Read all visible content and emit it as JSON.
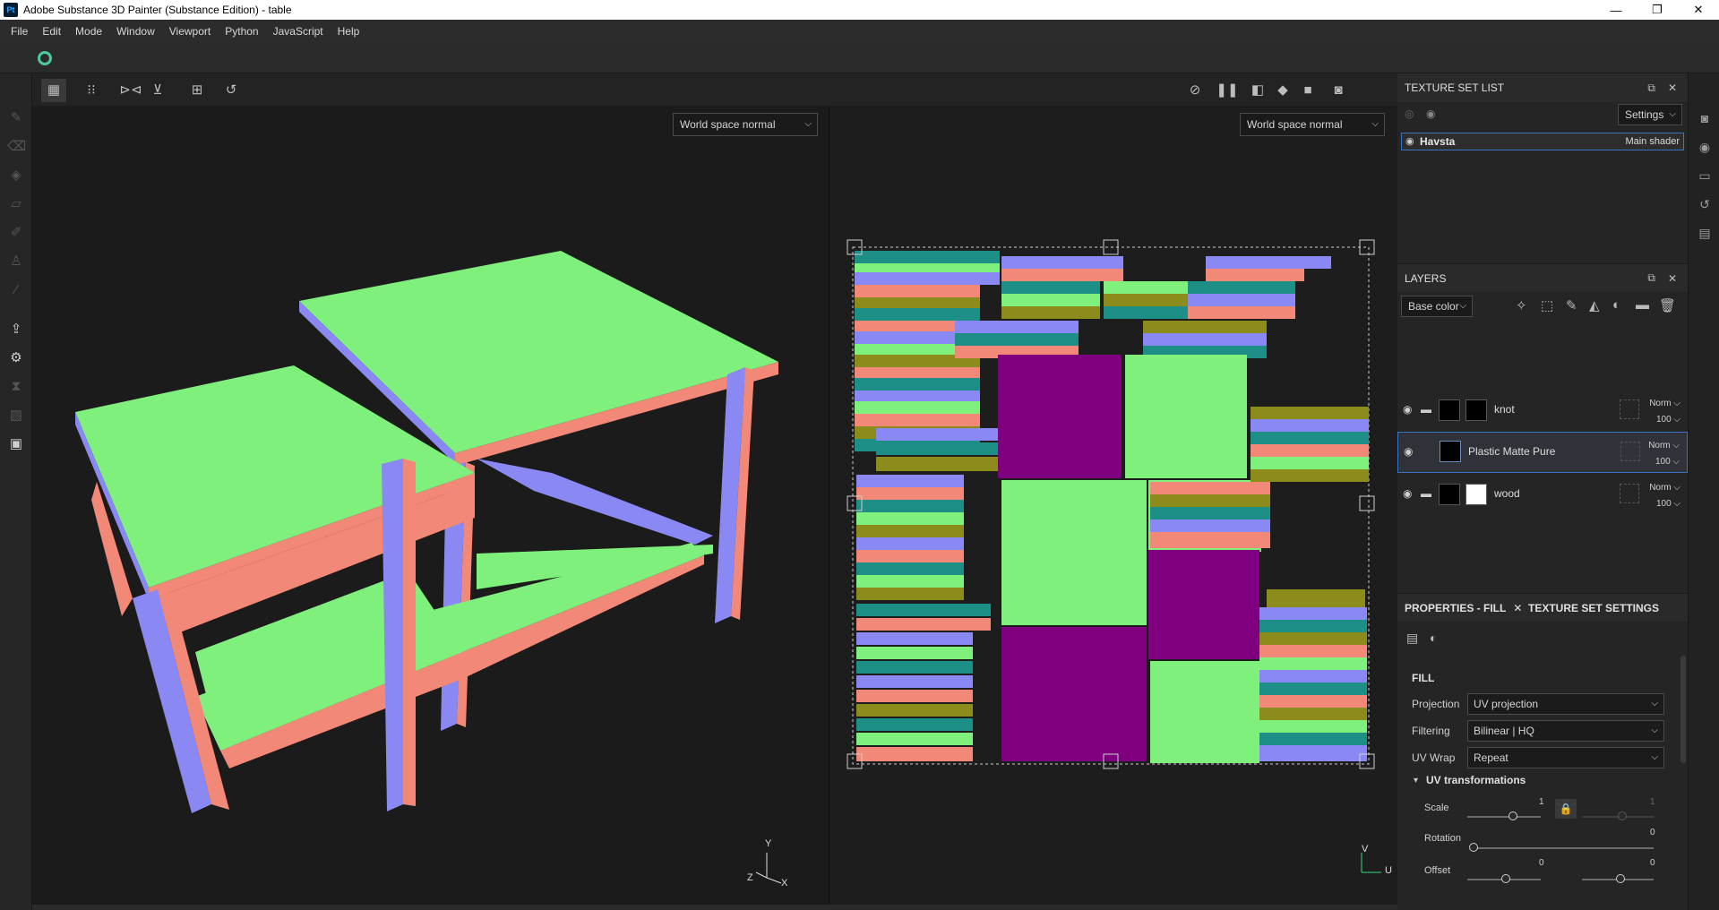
{
  "window": {
    "title": "Adobe Substance 3D Painter (Substance Edition) - table",
    "app_icon_label": "Pt",
    "minimize": "—",
    "maximize": "❐",
    "close": "✕"
  },
  "menu": [
    "File",
    "Edit",
    "Mode",
    "Window",
    "Viewport",
    "Python",
    "JavaScript",
    "Help"
  ],
  "viewport3d": {
    "channel": "World space normal"
  },
  "viewport2d": {
    "channel": "World space normal"
  },
  "gizmo3d": {
    "y": "Y",
    "x": "X",
    "z": "Z"
  },
  "gizmo2d": {
    "v": "V",
    "u": "U"
  },
  "texture_set_list": {
    "title": "TEXTURE SET LIST",
    "settings_label": "Settings",
    "item": {
      "name": "Havsta",
      "shader": "Main shader"
    }
  },
  "layers": {
    "title": "LAYERS",
    "channel": "Base color",
    "items": [
      {
        "name": "knot",
        "blend": "Norm",
        "opacity": "100"
      },
      {
        "name": "Plastic Matte Pure",
        "blend": "Norm",
        "opacity": "100"
      },
      {
        "name": "wood",
        "blend": "Norm",
        "opacity": "100"
      }
    ]
  },
  "properties": {
    "tab_fill": "PROPERTIES - FILL",
    "tab_tss": "TEXTURE SET SETTINGS",
    "section": "FILL",
    "projection_label": "Projection",
    "projection_value": "UV projection",
    "filtering_label": "Filtering",
    "filtering_value": "Bilinear | HQ",
    "uvwrap_label": "UV Wrap",
    "uvwrap_value": "Repeat",
    "uvtrans_label": "UV transformations",
    "scale_label": "Scale",
    "scale_value": "1",
    "scale_value2": "1",
    "rotation_label": "Rotation",
    "rotation_value": "0",
    "offset_label": "Offset",
    "offset_value1": "0",
    "offset_value2": "0"
  }
}
